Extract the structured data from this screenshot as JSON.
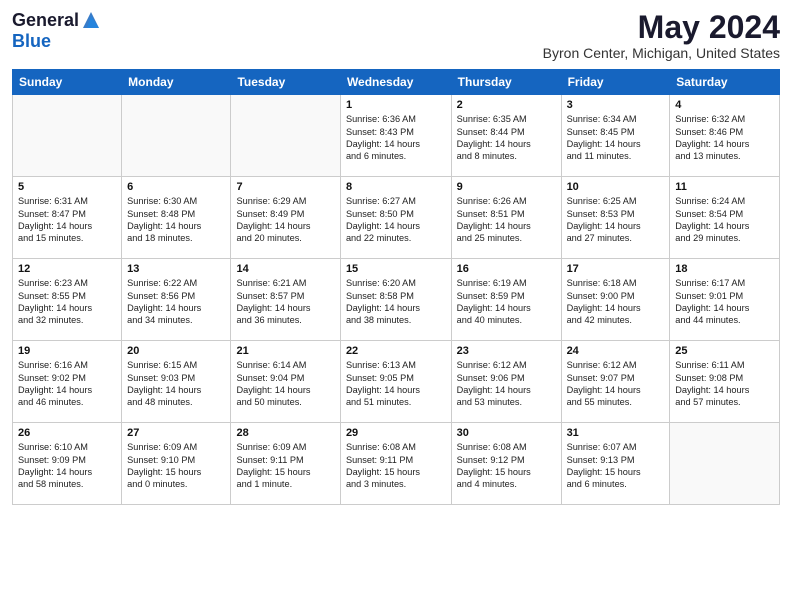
{
  "header": {
    "logo_line1": "General",
    "logo_line2": "Blue",
    "month_title": "May 2024",
    "location": "Byron Center, Michigan, United States"
  },
  "weekdays": [
    "Sunday",
    "Monday",
    "Tuesday",
    "Wednesday",
    "Thursday",
    "Friday",
    "Saturday"
  ],
  "weeks": [
    [
      {
        "day": "",
        "info": ""
      },
      {
        "day": "",
        "info": ""
      },
      {
        "day": "",
        "info": ""
      },
      {
        "day": "1",
        "info": "Sunrise: 6:36 AM\nSunset: 8:43 PM\nDaylight: 14 hours\nand 6 minutes."
      },
      {
        "day": "2",
        "info": "Sunrise: 6:35 AM\nSunset: 8:44 PM\nDaylight: 14 hours\nand 8 minutes."
      },
      {
        "day": "3",
        "info": "Sunrise: 6:34 AM\nSunset: 8:45 PM\nDaylight: 14 hours\nand 11 minutes."
      },
      {
        "day": "4",
        "info": "Sunrise: 6:32 AM\nSunset: 8:46 PM\nDaylight: 14 hours\nand 13 minutes."
      }
    ],
    [
      {
        "day": "5",
        "info": "Sunrise: 6:31 AM\nSunset: 8:47 PM\nDaylight: 14 hours\nand 15 minutes."
      },
      {
        "day": "6",
        "info": "Sunrise: 6:30 AM\nSunset: 8:48 PM\nDaylight: 14 hours\nand 18 minutes."
      },
      {
        "day": "7",
        "info": "Sunrise: 6:29 AM\nSunset: 8:49 PM\nDaylight: 14 hours\nand 20 minutes."
      },
      {
        "day": "8",
        "info": "Sunrise: 6:27 AM\nSunset: 8:50 PM\nDaylight: 14 hours\nand 22 minutes."
      },
      {
        "day": "9",
        "info": "Sunrise: 6:26 AM\nSunset: 8:51 PM\nDaylight: 14 hours\nand 25 minutes."
      },
      {
        "day": "10",
        "info": "Sunrise: 6:25 AM\nSunset: 8:53 PM\nDaylight: 14 hours\nand 27 minutes."
      },
      {
        "day": "11",
        "info": "Sunrise: 6:24 AM\nSunset: 8:54 PM\nDaylight: 14 hours\nand 29 minutes."
      }
    ],
    [
      {
        "day": "12",
        "info": "Sunrise: 6:23 AM\nSunset: 8:55 PM\nDaylight: 14 hours\nand 32 minutes."
      },
      {
        "day": "13",
        "info": "Sunrise: 6:22 AM\nSunset: 8:56 PM\nDaylight: 14 hours\nand 34 minutes."
      },
      {
        "day": "14",
        "info": "Sunrise: 6:21 AM\nSunset: 8:57 PM\nDaylight: 14 hours\nand 36 minutes."
      },
      {
        "day": "15",
        "info": "Sunrise: 6:20 AM\nSunset: 8:58 PM\nDaylight: 14 hours\nand 38 minutes."
      },
      {
        "day": "16",
        "info": "Sunrise: 6:19 AM\nSunset: 8:59 PM\nDaylight: 14 hours\nand 40 minutes."
      },
      {
        "day": "17",
        "info": "Sunrise: 6:18 AM\nSunset: 9:00 PM\nDaylight: 14 hours\nand 42 minutes."
      },
      {
        "day": "18",
        "info": "Sunrise: 6:17 AM\nSunset: 9:01 PM\nDaylight: 14 hours\nand 44 minutes."
      }
    ],
    [
      {
        "day": "19",
        "info": "Sunrise: 6:16 AM\nSunset: 9:02 PM\nDaylight: 14 hours\nand 46 minutes."
      },
      {
        "day": "20",
        "info": "Sunrise: 6:15 AM\nSunset: 9:03 PM\nDaylight: 14 hours\nand 48 minutes."
      },
      {
        "day": "21",
        "info": "Sunrise: 6:14 AM\nSunset: 9:04 PM\nDaylight: 14 hours\nand 50 minutes."
      },
      {
        "day": "22",
        "info": "Sunrise: 6:13 AM\nSunset: 9:05 PM\nDaylight: 14 hours\nand 51 minutes."
      },
      {
        "day": "23",
        "info": "Sunrise: 6:12 AM\nSunset: 9:06 PM\nDaylight: 14 hours\nand 53 minutes."
      },
      {
        "day": "24",
        "info": "Sunrise: 6:12 AM\nSunset: 9:07 PM\nDaylight: 14 hours\nand 55 minutes."
      },
      {
        "day": "25",
        "info": "Sunrise: 6:11 AM\nSunset: 9:08 PM\nDaylight: 14 hours\nand 57 minutes."
      }
    ],
    [
      {
        "day": "26",
        "info": "Sunrise: 6:10 AM\nSunset: 9:09 PM\nDaylight: 14 hours\nand 58 minutes."
      },
      {
        "day": "27",
        "info": "Sunrise: 6:09 AM\nSunset: 9:10 PM\nDaylight: 15 hours\nand 0 minutes."
      },
      {
        "day": "28",
        "info": "Sunrise: 6:09 AM\nSunset: 9:11 PM\nDaylight: 15 hours\nand 1 minute."
      },
      {
        "day": "29",
        "info": "Sunrise: 6:08 AM\nSunset: 9:11 PM\nDaylight: 15 hours\nand 3 minutes."
      },
      {
        "day": "30",
        "info": "Sunrise: 6:08 AM\nSunset: 9:12 PM\nDaylight: 15 hours\nand 4 minutes."
      },
      {
        "day": "31",
        "info": "Sunrise: 6:07 AM\nSunset: 9:13 PM\nDaylight: 15 hours\nand 6 minutes."
      },
      {
        "day": "",
        "info": ""
      }
    ]
  ]
}
